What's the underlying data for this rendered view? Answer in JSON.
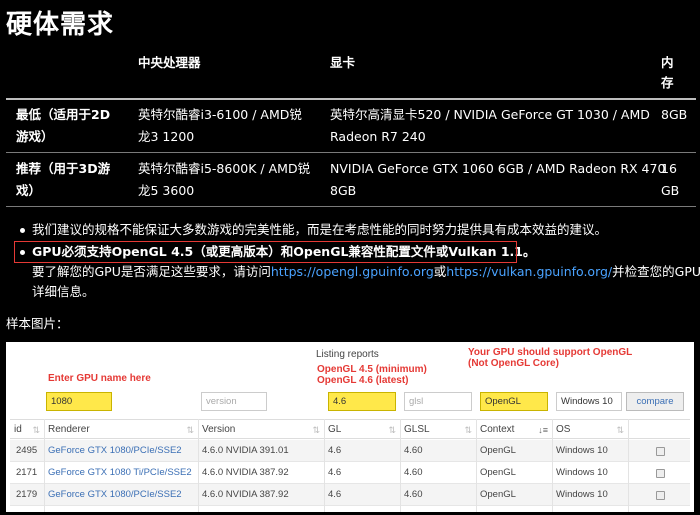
{
  "title": "硬体需求",
  "requirements": {
    "headers": {
      "cpu": "中央处理器",
      "gpu": "显卡",
      "ram_line1": "内",
      "ram_line2": "存"
    },
    "rows": [
      {
        "label_line1": "最低（适用于2D",
        "label_line2": "游戏）",
        "cpu_line1": "英特尔酷睿i3-6100 / AMD锐",
        "cpu_line2": "龙3 1200",
        "gpu_line1": "英特尔高清显卡520 / NVIDIA GeForce GT 1030 / AMD",
        "gpu_line2": "Radeon R7 240",
        "ram_line1": "8GB",
        "ram_line2": ""
      },
      {
        "label_line1": "推荐（用于3D游",
        "label_line2": "戏）",
        "cpu_line1": "英特尔酷睿i5-8600K / AMD锐",
        "cpu_line2": "龙5 3600",
        "gpu_line1": "NVIDIA GeForce GTX 1060 6GB / AMD Radeon RX 470",
        "gpu_line2": "8GB",
        "ram_line1": "16",
        "ram_line2": "GB"
      }
    ]
  },
  "notes": {
    "note1": "我们建议的规格不能保证大多数游戏的完美性能，而是在考虑性能的同时努力提供具有成本效益的建议。",
    "note2": "GPU必须支持OpenGL 4.5（或更高版本）和OpenGL兼容性配置文件或Vulkan 1.1。",
    "note3_prefix": "要了解您的GPU是否满足这些要求，请访问",
    "link1": "https://opengl.gpuinfo.org",
    "note3_or": "或",
    "link2": "https://vulkan.gpuinfo.org/",
    "note3_suffix": "并检查您的GPU",
    "note3_line2": "详细信息。"
  },
  "sample_label": "样本图片：",
  "sample": {
    "listing_reports": "Listing reports",
    "annotations": {
      "enter_gpu": "Enter GPU name here",
      "opengl_min": "OpenGL 4.5 (minimum)",
      "opengl_latest": "OpenGL 4.6 (latest)",
      "support_line1": "Your GPU should support OpenGL",
      "support_line2": "(Not OpenGL Core)"
    },
    "filters": {
      "renderer": "1080",
      "version_placeholder": "version",
      "gl": "4.6",
      "glsl_placeholder": "glsl",
      "context": "OpenGL",
      "os": "Windows 10",
      "compare": "compare"
    },
    "columns": [
      "id",
      "Renderer",
      "Version",
      "GL",
      "GLSL",
      "Context",
      "OS"
    ],
    "rows": [
      {
        "id": "2495",
        "renderer": "GeForce GTX 1080/PCIe/SSE2",
        "version": "4.6.0 NVIDIA 391.01",
        "gl": "4.6",
        "glsl": "4.60",
        "context": "OpenGL",
        "os": "Windows 10"
      },
      {
        "id": "2171",
        "renderer": "GeForce GTX 1080 Ti/PCIe/SSE2",
        "version": "4.6.0 NVIDIA 387.92",
        "gl": "4.6",
        "glsl": "4.60",
        "context": "OpenGL",
        "os": "Windows 10"
      },
      {
        "id": "2179",
        "renderer": "GeForce GTX 1080/PCIe/SSE2",
        "version": "4.6.0 NVIDIA 387.92",
        "gl": "4.6",
        "glsl": "4.60",
        "context": "OpenGL",
        "os": "Windows 10"
      }
    ]
  },
  "colors": {
    "accent_link": "#4aa3ff",
    "highlight_box": "#e53935",
    "filter_yellow": "#ffe84a"
  }
}
